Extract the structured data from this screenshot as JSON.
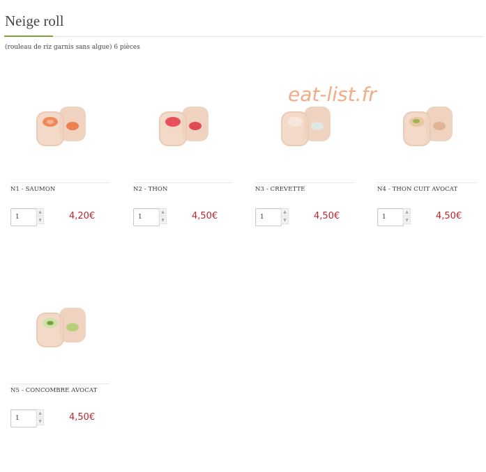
{
  "section": {
    "title": "Neige roll",
    "subtitle": "(rouleau de riz garnis sans algue) 6 pièces",
    "accent_color": "#7aa33a"
  },
  "watermark": "eat-list.fr",
  "products": [
    {
      "name": "N1 - SAUMON",
      "quantity": "1",
      "price": "4,20€",
      "filling": "salmon"
    },
    {
      "name": "N2 - THON",
      "quantity": "1",
      "price": "4,50€",
      "filling": "tuna"
    },
    {
      "name": "N3 - CREVETTE",
      "quantity": "1",
      "price": "4,50€",
      "filling": "shrimp"
    },
    {
      "name": "N4 - THON CUIT AVOCAT",
      "quantity": "1",
      "price": "4,50€",
      "filling": "cooked-tuna-avocado"
    },
    {
      "name": "N5 - CONCOMBRE AVOCAT",
      "quantity": "1",
      "price": "4,50€",
      "filling": "cucumber-avocado"
    }
  ],
  "price_color": "#b5272d"
}
